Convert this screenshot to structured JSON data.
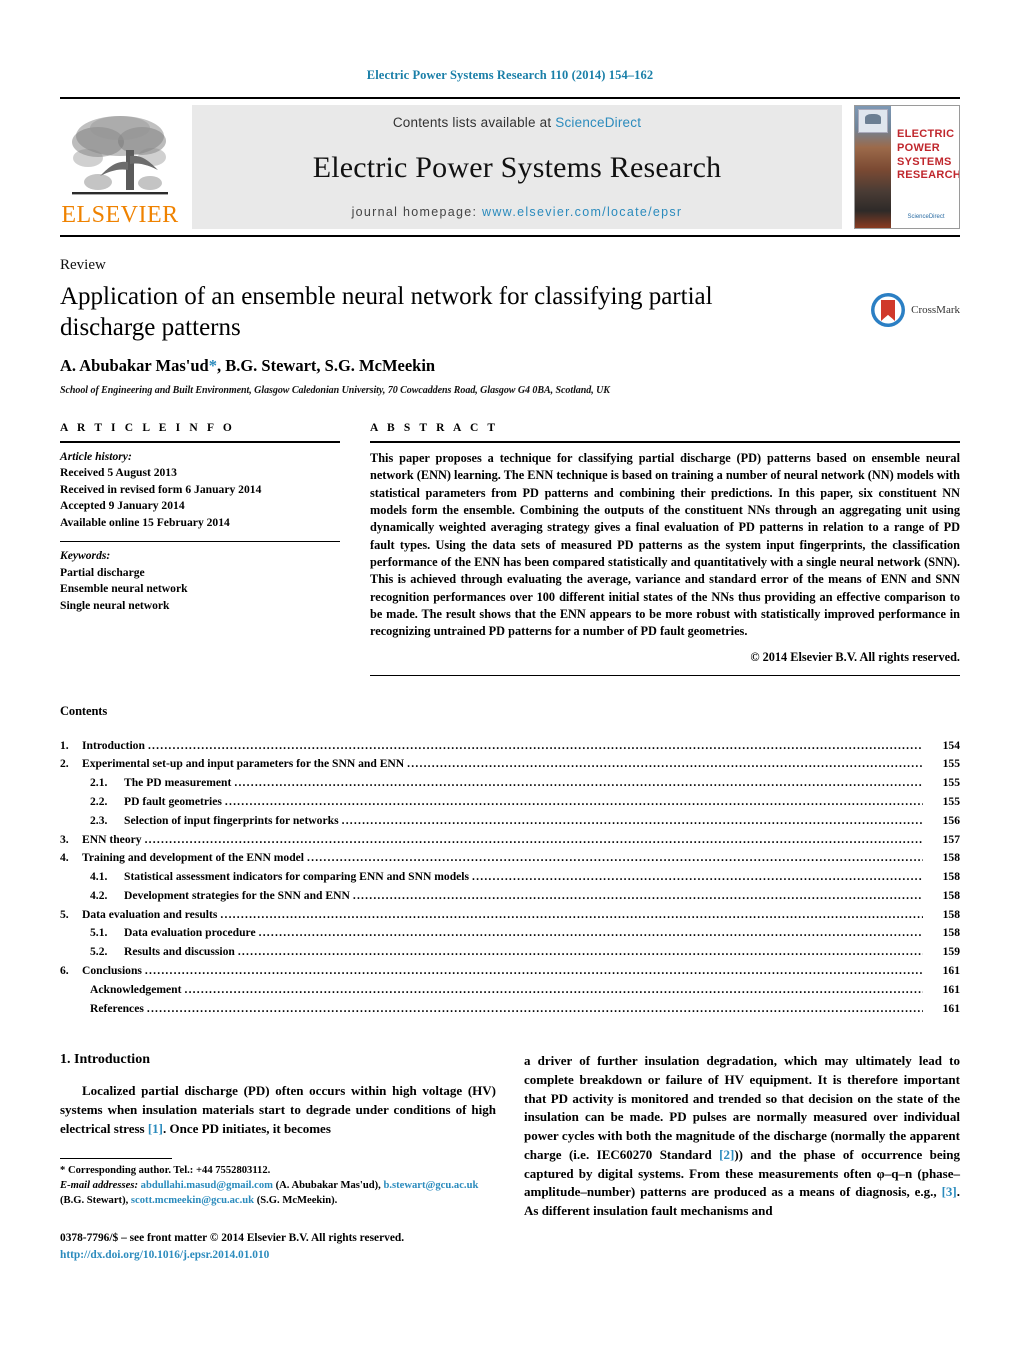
{
  "running_head": "Electric Power Systems Research 110 (2014) 154–162",
  "masthead": {
    "publisher_name": "ELSEVIER",
    "contents_prefix": "Contents lists available at ",
    "contents_link": "ScienceDirect",
    "journal_title": "Electric Power Systems Research",
    "homepage_prefix": "journal homepage:",
    "homepage_url": "www.elsevier.com/locate/epsr",
    "cover": {
      "title_line1": "ELECTRIC POWER",
      "title_line2": "SYSTEMS RESEARCH",
      "footer": "ScienceDirect"
    }
  },
  "article": {
    "doctype": "Review",
    "title": "Application of an ensemble neural network for classifying partial discharge patterns",
    "authors": "A. Abubakar Mas'ud",
    "corresponding_marker": "*",
    "authors_rest": ", B.G. Stewart, S.G. McMeekin",
    "affiliation": "School of Engineering and Built Environment, Glasgow Caledonian University, 70 Cowcaddens Road, Glasgow G4 0BA, Scotland, UK",
    "crossmark_label": "CrossMark"
  },
  "article_info": {
    "heading": "A R T I C L E    I N F O",
    "history_label": "Article history:",
    "history": [
      "Received 5 August 2013",
      "Received in revised form 6 January 2014",
      "Accepted 9 January 2014",
      "Available online 15 February 2014"
    ],
    "keywords_label": "Keywords:",
    "keywords": [
      "Partial discharge",
      "Ensemble neural network",
      "Single neural network"
    ]
  },
  "abstract": {
    "heading": "A B S T R A C T",
    "text": "This paper proposes a technique for classifying partial discharge (PD) patterns based on ensemble neural network (ENN) learning. The ENN technique is based on training a number of neural network (NN) models with statistical parameters from PD patterns and combining their predictions. In this paper, six constituent NN models form the ensemble. Combining the outputs of the constituent NNs through an aggregating unit using dynamically weighted averaging strategy gives a final evaluation of PD patterns in relation to a range of PD fault types. Using the data sets of measured PD patterns as the system input fingerprints, the classification performance of the ENN has been compared statistically and quantitatively with a single neural network (SNN). This is achieved through evaluating the average, variance and standard error of the means of ENN and SNN recognition performances over 100 different initial states of the NNs thus providing an effective comparison to be made. The result shows that the ENN appears to be more robust with statistically improved performance in recognizing untrained PD patterns for a number of PD fault geometries.",
    "copyright": "© 2014 Elsevier B.V. All rights reserved."
  },
  "contents": {
    "heading": "Contents",
    "entries": [
      {
        "num": "1.",
        "sub": "",
        "label": "Introduction",
        "page": "154",
        "level": 1
      },
      {
        "num": "2.",
        "sub": "",
        "label": "Experimental set-up and input parameters for the SNN and ENN",
        "page": "155",
        "level": 1
      },
      {
        "num": "",
        "sub": "2.1.",
        "label": "The PD measurement",
        "page": "155",
        "level": 2
      },
      {
        "num": "",
        "sub": "2.2.",
        "label": "PD fault geometries",
        "page": "155",
        "level": 2
      },
      {
        "num": "",
        "sub": "2.3.",
        "label": "Selection of input fingerprints for networks",
        "page": "156",
        "level": 2
      },
      {
        "num": "3.",
        "sub": "",
        "label": "ENN theory",
        "page": "157",
        "level": 1
      },
      {
        "num": "4.",
        "sub": "",
        "label": "Training and development of the ENN model",
        "page": "158",
        "level": 1
      },
      {
        "num": "",
        "sub": "4.1.",
        "label": "Statistical assessment indicators for comparing ENN and SNN models",
        "page": "158",
        "level": 2
      },
      {
        "num": "",
        "sub": "4.2.",
        "label": "Development strategies for the SNN and ENN",
        "page": "158",
        "level": 2
      },
      {
        "num": "5.",
        "sub": "",
        "label": "Data evaluation and results",
        "page": "158",
        "level": 1
      },
      {
        "num": "",
        "sub": "5.1.",
        "label": "Data evaluation procedure",
        "page": "158",
        "level": 2
      },
      {
        "num": "",
        "sub": "5.2.",
        "label": "Results and discussion",
        "page": "159",
        "level": 2
      },
      {
        "num": "6.",
        "sub": "",
        "label": "Conclusions",
        "page": "161",
        "level": 1
      },
      {
        "num": "",
        "sub": "",
        "label": "Acknowledgement",
        "page": "161",
        "level": 3
      },
      {
        "num": "",
        "sub": "",
        "label": "References",
        "page": "161",
        "level": 3
      }
    ]
  },
  "introduction": {
    "heading": "1.  Introduction",
    "left_para_a": "Localized partial discharge (PD) often occurs within high voltage (HV) systems when insulation materials start to degrade under conditions of high electrical stress ",
    "left_ref_1": "[1]",
    "left_para_b": ". Once PD initiates, it becomes",
    "right_para_a": "a driver of further insulation degradation, which may ultimately lead to complete breakdown or failure of HV equipment. It is therefore important that PD activity is monitored and trended so that decision on the state of the insulation can be made. PD pulses are normally measured over individual power cycles with both the magnitude of the discharge (normally the apparent charge (i.e. IEC60270 Standard ",
    "right_ref_2": "[2]",
    "right_para_b": ")) and the phase of occurrence being captured by digital systems. From these measurements often φ–q–n (phase–amplitude–number) patterns are produced as a means of diagnosis, e.g., ",
    "right_ref_3": "[3]",
    "right_para_c": ". As different insulation fault mechanisms and"
  },
  "footnote": {
    "corresponding_marker": "*",
    "corresponding_text": " Corresponding author. Tel.: +44 7552803112.",
    "email_label": "E-mail addresses:",
    "emails": [
      {
        "address": "abdullahi.masud@gmail.com",
        "owner": " (A. Abubakar Mas'ud),"
      },
      {
        "address": "b.stewart@gcu.ac.uk",
        "owner": " (B.G. Stewart),"
      },
      {
        "address": "scott.mcmeekin@gcu.ac.uk",
        "owner": " (S.G. McMeekin)."
      }
    ]
  },
  "imprint": {
    "issn_line": "0378-7796/$ – see front matter © 2014 Elsevier B.V. All rights reserved.",
    "doi": "http://dx.doi.org/10.1016/j.epsr.2014.01.010"
  },
  "colors": {
    "link_blue": "#2b8bbd",
    "header_blue": "#1a7fa8",
    "elsevier_orange": "#ef8200",
    "cover_red": "#c0272d"
  }
}
